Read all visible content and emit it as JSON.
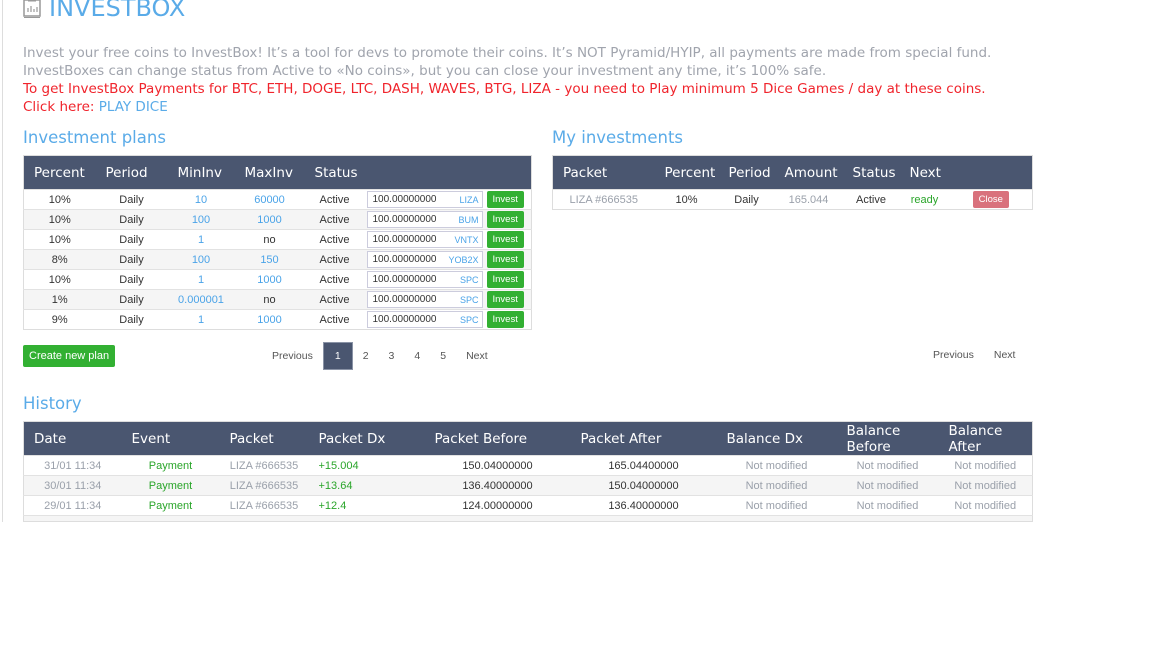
{
  "title": "INVESTBOX",
  "intro": {
    "line1": "Invest your free coins to InvestBox! It’s a tool for devs to promote their coins. It’s NOT Pyramid/HYIP, all payments are made from special fund.",
    "line2": "InvestBoxes can change status from Active to «No coins», but you can close your investment any time, it’s 100% safe.",
    "line3": "To get InvestBox Payments for BTC, ETH, DOGE, LTC, DASH, WAVES, BTG, LIZA - you need to Play minimum 5 Dice Games / day at these coins.",
    "click_label": "Click here:",
    "click_link": "PLAY DICE"
  },
  "plans": {
    "heading": "Investment plans",
    "columns": [
      "Percent",
      "Period",
      "MinInv",
      "MaxInv",
      "Status"
    ],
    "rows": [
      {
        "percent": "10%",
        "period": "Daily",
        "min": "10",
        "max": "60000",
        "status": "Active",
        "amount": "100.00000000",
        "coin": "LIZA",
        "button": "Invest"
      },
      {
        "percent": "10%",
        "period": "Daily",
        "min": "100",
        "max": "1000",
        "status": "Active",
        "amount": "100.00000000",
        "coin": "BUM",
        "button": "Invest"
      },
      {
        "percent": "10%",
        "period": "Daily",
        "min": "1",
        "max": "no",
        "status": "Active",
        "amount": "100.00000000",
        "coin": "VNTX",
        "button": "Invest"
      },
      {
        "percent": "8%",
        "period": "Daily",
        "min": "100",
        "max": "150",
        "status": "Active",
        "amount": "100.00000000",
        "coin": "YOB2X",
        "button": "Invest"
      },
      {
        "percent": "10%",
        "period": "Daily",
        "min": "1",
        "max": "1000",
        "status": "Active",
        "amount": "100.00000000",
        "coin": "SPC",
        "button": "Invest"
      },
      {
        "percent": "1%",
        "period": "Daily",
        "min": "0.000001",
        "max": "no",
        "status": "Active",
        "amount": "100.00000000",
        "coin": "SPC",
        "button": "Invest"
      },
      {
        "percent": "9%",
        "period": "Daily",
        "min": "1",
        "max": "1000",
        "status": "Active",
        "amount": "100.00000000",
        "coin": "SPC",
        "button": "Invest"
      }
    ],
    "create_button": "Create new plan",
    "pager": {
      "prev": "Previous",
      "pages": [
        "1",
        "2",
        "3",
        "4",
        "5"
      ],
      "active": "1",
      "next": "Next"
    }
  },
  "my": {
    "heading": "My investments",
    "columns": [
      "Packet",
      "Percent",
      "Period",
      "Amount",
      "Status",
      "Next"
    ],
    "rows": [
      {
        "packet": "LIZA #666535",
        "percent": "10%",
        "period": "Daily",
        "amount": "165.044",
        "status": "Active",
        "next": "ready",
        "button": "Close"
      }
    ],
    "pager": {
      "prev": "Previous",
      "next": "Next"
    }
  },
  "history": {
    "heading": "History",
    "columns": [
      "Date",
      "Event",
      "Packet",
      "Packet Dx",
      "Packet Before",
      "Packet After",
      "Balance Dx",
      "Balance Before",
      "Balance After"
    ],
    "rows": [
      {
        "date": "31/01 11:34",
        "event": "Payment",
        "packet": "LIZA #666535",
        "dx": "+15.004",
        "before": "150.04000000",
        "after": "165.04400000",
        "bdx": "Not modified",
        "bbefore": "Not modified",
        "bafter": "Not modified"
      },
      {
        "date": "30/01 11:34",
        "event": "Payment",
        "packet": "LIZA #666535",
        "dx": "+13.64",
        "before": "136.40000000",
        "after": "150.04000000",
        "bdx": "Not modified",
        "bbefore": "Not modified",
        "bafter": "Not modified"
      },
      {
        "date": "29/01 11:34",
        "event": "Payment",
        "packet": "LIZA #666535",
        "dx": "+12.4",
        "before": "124.00000000",
        "after": "136.40000000",
        "bdx": "Not modified",
        "bbefore": "Not modified",
        "bafter": "Not modified"
      }
    ]
  }
}
